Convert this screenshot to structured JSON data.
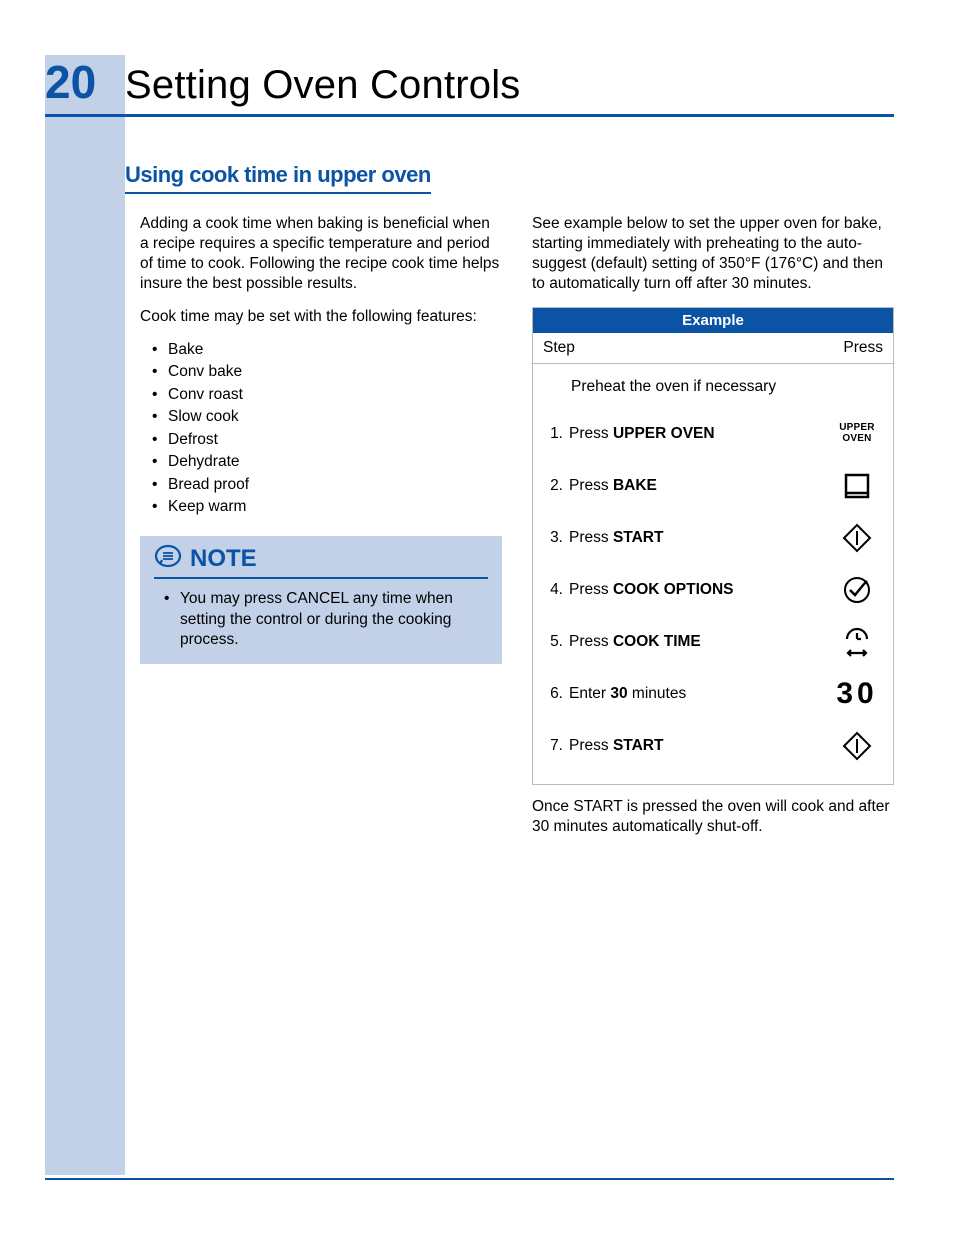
{
  "page_number": "20",
  "page_title": "Setting Oven Controls",
  "section_heading": "Using cook time in upper oven",
  "left_para1": "Adding a cook time when baking is beneficial when a recipe requires a specific temperature and period of time to cook. Following the recipe cook time helps insure the best possible results.",
  "left_para2": "Cook time may be set with the following features:",
  "features": [
    "Bake",
    "Conv bake",
    "Conv roast",
    "Slow cook",
    "Defrost",
    "Dehydrate",
    "Bread proof",
    "Keep warm"
  ],
  "note": {
    "title": "NOTE",
    "item": "You may press CANCEL any time when setting the control or during the cooking process."
  },
  "right_para": "See example below to set the upper oven for bake, starting immediately with preheating to the auto-suggest (default) setting of 350°F (176°C) and then to automatically turn off after 30 minutes.",
  "example": {
    "title": "Example",
    "col_step": "Step",
    "col_press": "Press",
    "preheat": "Preheat the oven if necessary",
    "rows": [
      {
        "n": "1.",
        "pre": "Press ",
        "bold": "UPPER OVEN",
        "post": "",
        "icon": "upper-oven"
      },
      {
        "n": "2.",
        "pre": "Press ",
        "bold": "BAKE",
        "post": "",
        "icon": "bake"
      },
      {
        "n": "3.",
        "pre": "Press ",
        "bold": "START",
        "post": "",
        "icon": "start"
      },
      {
        "n": "4.",
        "pre": "Press ",
        "bold": "COOK OPTIONS",
        "post": "",
        "icon": "cook-options"
      },
      {
        "n": "5.",
        "pre": "Press ",
        "bold": "COOK TIME",
        "post": "",
        "icon": "cook-time"
      },
      {
        "n": "6.",
        "pre": "Enter ",
        "bold": "30",
        "post": " minutes",
        "icon": "digits-30"
      },
      {
        "n": "7.",
        "pre": "Press ",
        "bold": "START",
        "post": "",
        "icon": "start"
      }
    ],
    "upper_oven_label_1": "UPPER",
    "upper_oven_label_2": "OVEN",
    "digits_30": "30"
  },
  "after_table": "Once START is pressed the oven will cook and after 30 minutes automatically shut-off."
}
